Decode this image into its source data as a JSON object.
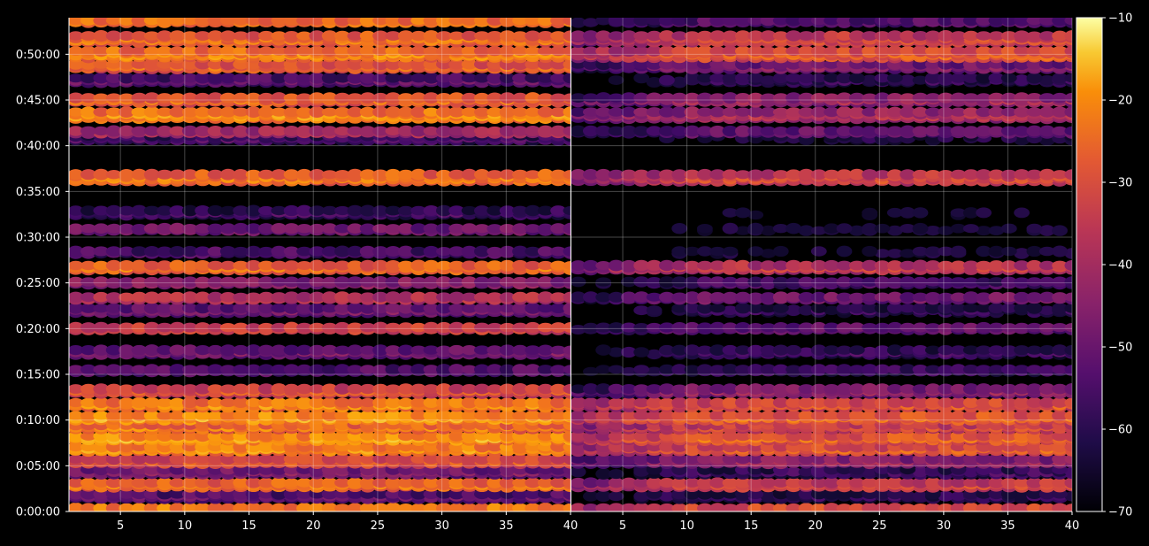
{
  "chart_data": {
    "type": "heatmap",
    "colormap": "inferno",
    "background": "#000000",
    "grid": true,
    "panels": [
      {
        "name": "",
        "xlim": [
          1,
          40
        ],
        "xticks": [
          "5",
          "10",
          "15",
          "20",
          "25",
          "30",
          "35",
          "40"
        ],
        "xtick_values": [
          5,
          10,
          15,
          20,
          25,
          30,
          35,
          40
        ]
      },
      {
        "name": "",
        "xlim": [
          1,
          40
        ],
        "xticks": [
          "5",
          "10",
          "15",
          "20",
          "25",
          "30",
          "35",
          "40"
        ],
        "xtick_values": [
          5,
          10,
          15,
          20,
          25,
          30,
          35,
          40
        ]
      }
    ],
    "y_axis": {
      "unit": "seconds",
      "ylim": [
        0,
        3240
      ],
      "ticks": [
        "0:00:00",
        "0:05:00",
        "0:10:00",
        "0:15:00",
        "0:20:00",
        "0:25:00",
        "0:30:00",
        "0:35:00",
        "0:40:00",
        "0:45:00",
        "0:50:00"
      ],
      "tick_values": [
        0,
        300,
        600,
        900,
        1200,
        1500,
        1800,
        2100,
        2400,
        2700,
        3000
      ]
    },
    "colorbar": {
      "range": [
        -70,
        -10
      ],
      "ticks": [
        "−10",
        "−20",
        "−30",
        "−40",
        "−50",
        "−60",
        "−70"
      ],
      "tick_values": [
        -10,
        -20,
        -30,
        -40,
        -50,
        -60,
        -70
      ]
    },
    "bands": [
      {
        "t": 15,
        "spread": 30,
        "left": -26,
        "right": -34
      },
      {
        "t": 100,
        "spread": 45,
        "left": -52,
        "right": -60
      },
      {
        "t": 175,
        "spread": 45,
        "left": -28,
        "right": -36
      },
      {
        "t": 260,
        "spread": 45,
        "left": -48,
        "right": -58
      },
      {
        "t": 330,
        "spread": 35,
        "left": -33,
        "right": -45
      },
      {
        "t": 410,
        "spread": 45,
        "left": -24,
        "right": -32
      },
      {
        "t": 480,
        "spread": 45,
        "left": -22,
        "right": -30
      },
      {
        "t": 555,
        "spread": 35,
        "left": -27,
        "right": -35
      },
      {
        "t": 615,
        "spread": 45,
        "left": -22,
        "right": -30
      },
      {
        "t": 700,
        "spread": 45,
        "left": -25,
        "right": -33
      },
      {
        "t": 790,
        "spread": 35,
        "left": -34,
        "right": -46
      },
      {
        "t": 925,
        "spread": 30,
        "left": -54,
        "right": -58
      },
      {
        "t": 1045,
        "spread": 40,
        "left": -50,
        "right": -58
      },
      {
        "t": 1200,
        "spread": 30,
        "left": -36,
        "right": -52
      },
      {
        "t": 1320,
        "spread": 35,
        "left": -50,
        "right": -60
      },
      {
        "t": 1400,
        "spread": 30,
        "left": -40,
        "right": -50
      },
      {
        "t": 1500,
        "spread": 30,
        "left": -47,
        "right": -56
      },
      {
        "t": 1600,
        "spread": 45,
        "left": -28,
        "right": -38
      },
      {
        "t": 1700,
        "spread": 30,
        "left": -55,
        "right": -64
      },
      {
        "t": 1850,
        "spread": 30,
        "left": -50,
        "right": -64
      },
      {
        "t": 1960,
        "spread": 35,
        "left": -57,
        "right": -66
      },
      {
        "t": 2190,
        "spread": 60,
        "left": -26,
        "right": -34
      },
      {
        "t": 2450,
        "spread": 35,
        "left": -56,
        "right": -64
      },
      {
        "t": 2490,
        "spread": 30,
        "left": -42,
        "right": -52
      },
      {
        "t": 2600,
        "spread": 50,
        "left": -23,
        "right": -40
      },
      {
        "t": 2700,
        "spread": 45,
        "left": -30,
        "right": -44
      },
      {
        "t": 2830,
        "spread": 45,
        "left": -53,
        "right": -60
      },
      {
        "t": 2920,
        "spread": 35,
        "left": -30,
        "right": -48
      },
      {
        "t": 3000,
        "spread": 50,
        "left": -24,
        "right": -30
      },
      {
        "t": 3100,
        "spread": 50,
        "left": -27,
        "right": -34
      },
      {
        "t": 3215,
        "spread": 25,
        "left": -28,
        "right": -54
      }
    ]
  }
}
